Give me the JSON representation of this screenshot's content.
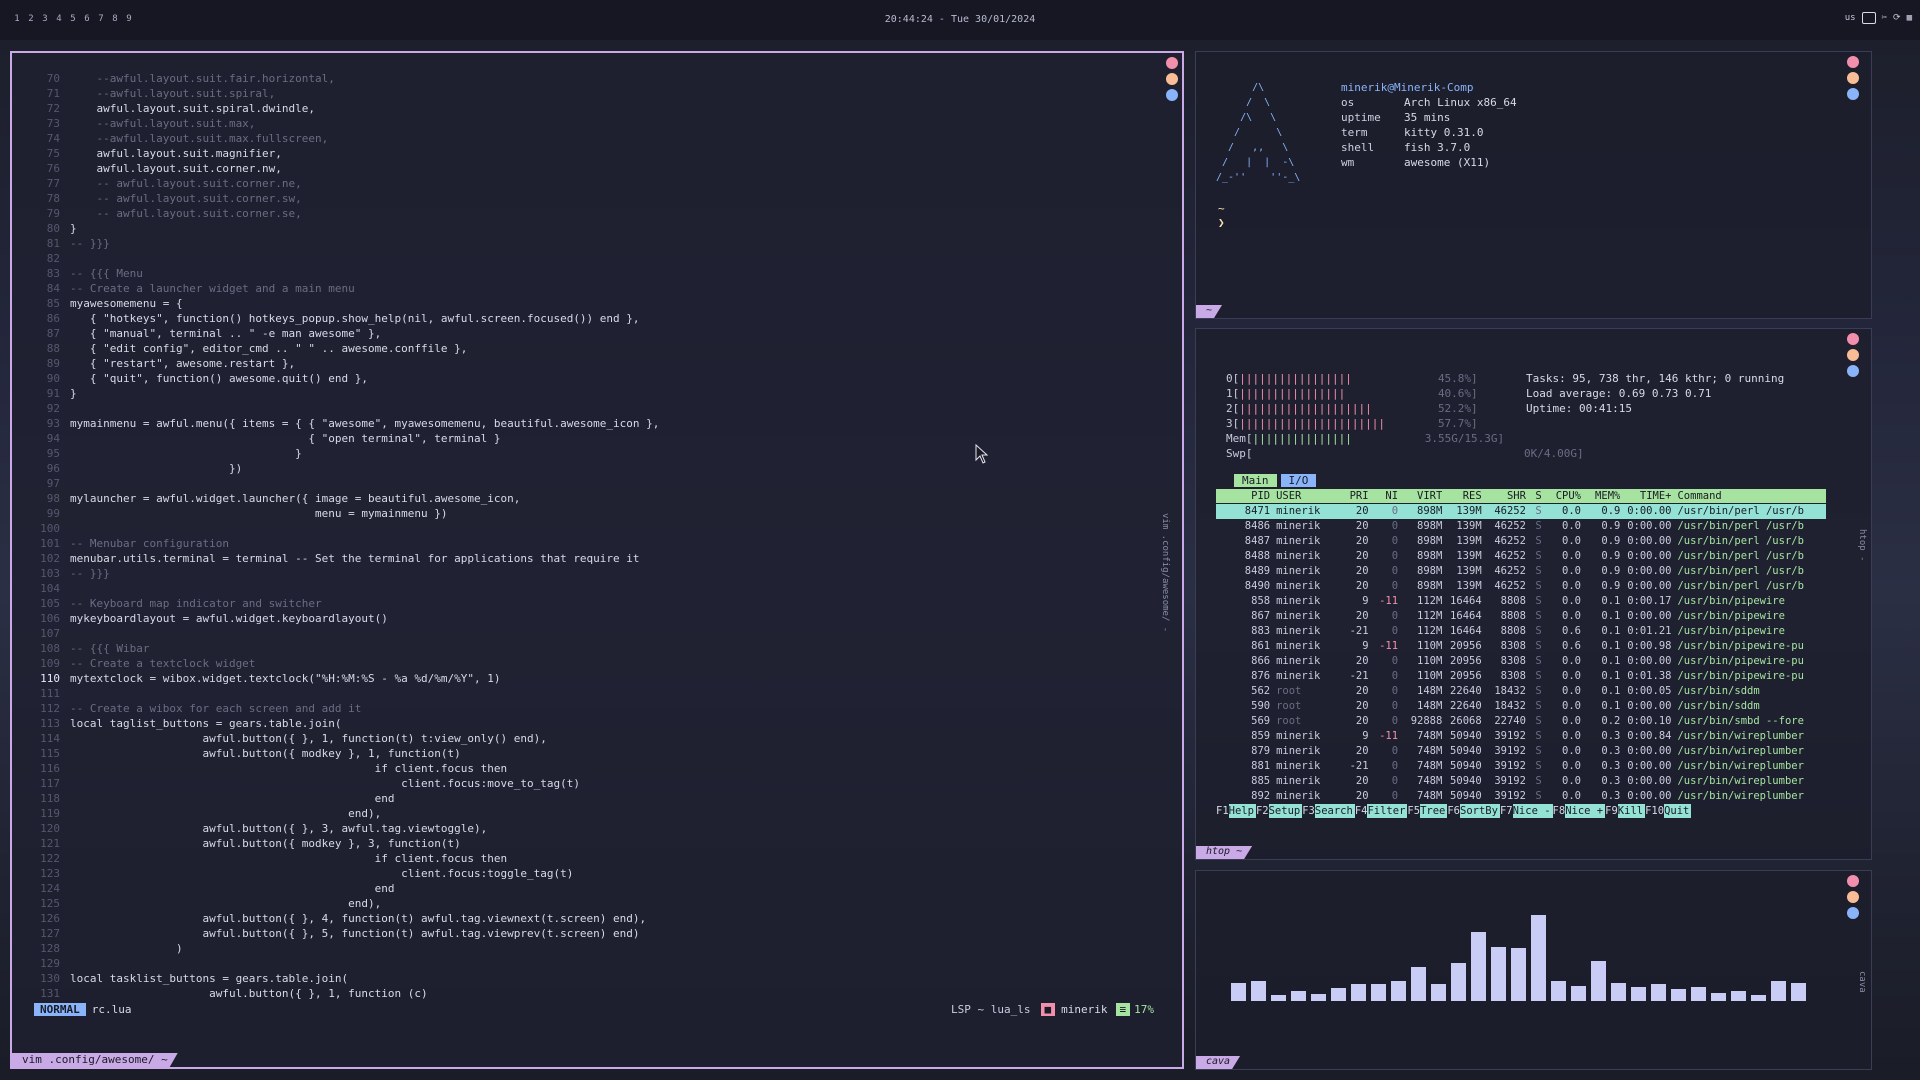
{
  "topbar": {
    "tags": [
      "1",
      "2",
      "3",
      "4",
      "5",
      "6",
      "7",
      "8",
      "9"
    ],
    "clock": "20:44:24 - Tue 30/01/2024",
    "layout": "us"
  },
  "vim": {
    "lines": [
      {
        "n": "70",
        "t": "    --awful.layout.suit.fair.horizontal,",
        "c": true
      },
      {
        "n": "71",
        "t": "    --awful.layout.suit.spiral,",
        "c": true
      },
      {
        "n": "72",
        "t": "    awful.layout.suit.spiral.dwindle,"
      },
      {
        "n": "73",
        "t": "    --awful.layout.suit.max,",
        "c": true
      },
      {
        "n": "74",
        "t": "    --awful.layout.suit.max.fullscreen,",
        "c": true
      },
      {
        "n": "75",
        "t": "    awful.layout.suit.magnifier,"
      },
      {
        "n": "76",
        "t": "    awful.layout.suit.corner.nw,"
      },
      {
        "n": "77",
        "t": "    -- awful.layout.suit.corner.ne,",
        "c": true
      },
      {
        "n": "78",
        "t": "    -- awful.layout.suit.corner.sw,",
        "c": true
      },
      {
        "n": "79",
        "t": "    -- awful.layout.suit.corner.se,",
        "c": true
      },
      {
        "n": "80",
        "t": "}"
      },
      {
        "n": "81",
        "t": "-- }}}",
        "c": true
      },
      {
        "n": "82",
        "t": ""
      },
      {
        "n": "83",
        "t": "-- {{{ Menu",
        "c": true
      },
      {
        "n": "84",
        "t": "-- Create a launcher widget and a main menu",
        "c": true
      },
      {
        "n": "85",
        "t": "myawesomemenu = {"
      },
      {
        "n": "86",
        "t": "   { \"hotkeys\", function() hotkeys_popup.show_help(nil, awful.screen.focused()) end },"
      },
      {
        "n": "87",
        "t": "   { \"manual\", terminal .. \" -e man awesome\" },"
      },
      {
        "n": "88",
        "t": "   { \"edit config\", editor_cmd .. \" \" .. awesome.conffile },"
      },
      {
        "n": "89",
        "t": "   { \"restart\", awesome.restart },"
      },
      {
        "n": "90",
        "t": "   { \"quit\", function() awesome.quit() end },"
      },
      {
        "n": "91",
        "t": "}"
      },
      {
        "n": "92",
        "t": ""
      },
      {
        "n": "93",
        "t": "mymainmenu = awful.menu({ items = { { \"awesome\", myawesomemenu, beautiful.awesome_icon },"
      },
      {
        "n": "94",
        "t": "                                    { \"open terminal\", terminal }"
      },
      {
        "n": "95",
        "t": "                                  }"
      },
      {
        "n": "96",
        "t": "                        })"
      },
      {
        "n": "97",
        "t": ""
      },
      {
        "n": "98",
        "t": "mylauncher = awful.widget.launcher({ image = beautiful.awesome_icon,"
      },
      {
        "n": "99",
        "t": "                                     menu = mymainmenu })"
      },
      {
        "n": "100",
        "t": ""
      },
      {
        "n": "101",
        "t": "-- Menubar configuration",
        "c": true
      },
      {
        "n": "102",
        "t": "menubar.utils.terminal = terminal -- Set the terminal for applications that require it"
      },
      {
        "n": "103",
        "t": "-- }}}",
        "c": true
      },
      {
        "n": "104",
        "t": ""
      },
      {
        "n": "105",
        "t": "-- Keyboard map indicator and switcher",
        "c": true
      },
      {
        "n": "106",
        "t": "mykeyboardlayout = awful.widget.keyboardlayout()"
      },
      {
        "n": "107",
        "t": ""
      },
      {
        "n": "108",
        "t": "-- {{{ Wibar",
        "c": true
      },
      {
        "n": "109",
        "t": "-- Create a textclock widget",
        "c": true
      },
      {
        "n": "110",
        "t": "mytextclock = wibox.widget.textclock(\"%H:%M:%S - %a %d/%m/%Y\", 1)",
        "cur": true
      },
      {
        "n": "111",
        "t": ""
      },
      {
        "n": "112",
        "t": "-- Create a wibox for each screen and add it",
        "c": true
      },
      {
        "n": "113",
        "t": "local taglist_buttons = gears.table.join("
      },
      {
        "n": "114",
        "t": "                    awful.button({ }, 1, function(t) t:view_only() end),"
      },
      {
        "n": "115",
        "t": "                    awful.button({ modkey }, 1, function(t)"
      },
      {
        "n": "116",
        "t": "                                              if client.focus then"
      },
      {
        "n": "117",
        "t": "                                                  client.focus:move_to_tag(t)"
      },
      {
        "n": "118",
        "t": "                                              end"
      },
      {
        "n": "119",
        "t": "                                          end),"
      },
      {
        "n": "120",
        "t": "                    awful.button({ }, 3, awful.tag.viewtoggle),"
      },
      {
        "n": "121",
        "t": "                    awful.button({ modkey }, 3, function(t)"
      },
      {
        "n": "122",
        "t": "                                              if client.focus then"
      },
      {
        "n": "123",
        "t": "                                                  client.focus:toggle_tag(t)"
      },
      {
        "n": "124",
        "t": "                                              end"
      },
      {
        "n": "125",
        "t": "                                          end),"
      },
      {
        "n": "126",
        "t": "                    awful.button({ }, 4, function(t) awful.tag.viewnext(t.screen) end),"
      },
      {
        "n": "127",
        "t": "                    awful.button({ }, 5, function(t) awful.tag.viewprev(t.screen) end)"
      },
      {
        "n": "128",
        "t": "                )"
      },
      {
        "n": "129",
        "t": ""
      },
      {
        "n": "130",
        "t": "local tasklist_buttons = gears.table.join("
      },
      {
        "n": "131",
        "t": "                     awful.button({ }, 1, function (c)"
      }
    ],
    "mode": "NORMAL",
    "file": "rc.lua",
    "lsp": "LSP ~ lua_ls",
    "user": "minerik",
    "percent": "17%",
    "side_title": "vim .config/awesome/ -",
    "tab": "vim .config/awesome/ ~"
  },
  "fetch": {
    "ascii": "      /\\\n     /  \\\n    /\\   \\\n   /      \\\n  /   ,,   \\\n /   |  |  -\\\n/_-''    ''-_\\",
    "host": "minerik@Minerik-Comp",
    "rows": [
      {
        "k": "os",
        "v": "Arch Linux x86_64"
      },
      {
        "k": "uptime",
        "v": "35 mins"
      },
      {
        "k": "term",
        "v": "kitty 0.31.0"
      },
      {
        "k": "shell",
        "v": "fish 3.7.0"
      },
      {
        "k": "wm",
        "v": "awesome (X11)"
      }
    ],
    "prompt1": "~",
    "prompt2": "❯",
    "tab": "~"
  },
  "htop": {
    "cpus": [
      {
        "l": "0[",
        "b": "|||||||||||||||||",
        "p": "45.8%]"
      },
      {
        "l": "1[",
        "b": "||||||||||||||||",
        "p": "40.6%]"
      },
      {
        "l": "2[",
        "b": "||||||||||||||||||||",
        "p": "52.2%]"
      },
      {
        "l": "3[",
        "b": "||||||||||||||||||||||",
        "p": "57.7%]"
      }
    ],
    "mem": {
      "l": "Mem[",
      "b": "|||||||||||||||",
      "p": "3.55G/15.3G]"
    },
    "swp": {
      "l": "Swp[",
      "b": "",
      "p": "0K/4.00G]"
    },
    "tasks_line": "Tasks: 95, 738 thr, 146 kthr; 0 running",
    "load_line": "Load average: 0.69 0.73 0.71",
    "uptime_line": "Uptime: 00:41:15",
    "tabs": [
      "Main",
      "I/O"
    ],
    "headers": [
      "PID",
      "USER",
      "PRI",
      "NI",
      "VIRT",
      "RES",
      "SHR",
      "S",
      "CPU%",
      "MEM%",
      "TIME+",
      "Command"
    ],
    "procs": [
      [
        "8471",
        "minerik",
        "20",
        "0",
        "898M",
        "139M",
        "46252",
        "S",
        "0.0",
        "0.9",
        "0:00.00",
        "/usr/bin/perl /usr/b"
      ],
      [
        "8486",
        "minerik",
        "20",
        "0",
        "898M",
        "139M",
        "46252",
        "S",
        "0.0",
        "0.9",
        "0:00.00",
        "/usr/bin/perl /usr/b"
      ],
      [
        "8487",
        "minerik",
        "20",
        "0",
        "898M",
        "139M",
        "46252",
        "S",
        "0.0",
        "0.9",
        "0:00.00",
        "/usr/bin/perl /usr/b"
      ],
      [
        "8488",
        "minerik",
        "20",
        "0",
        "898M",
        "139M",
        "46252",
        "S",
        "0.0",
        "0.9",
        "0:00.00",
        "/usr/bin/perl /usr/b"
      ],
      [
        "8489",
        "minerik",
        "20",
        "0",
        "898M",
        "139M",
        "46252",
        "S",
        "0.0",
        "0.9",
        "0:00.00",
        "/usr/bin/perl /usr/b"
      ],
      [
        "8490",
        "minerik",
        "20",
        "0",
        "898M",
        "139M",
        "46252",
        "S",
        "0.0",
        "0.9",
        "0:00.00",
        "/usr/bin/perl /usr/b"
      ],
      [
        "858",
        "minerik",
        "9",
        "-11",
        "112M",
        "16464",
        "8808",
        "S",
        "0.0",
        "0.1",
        "0:00.17",
        "/usr/bin/pipewire"
      ],
      [
        "867",
        "minerik",
        "20",
        "0",
        "112M",
        "16464",
        "8808",
        "S",
        "0.0",
        "0.1",
        "0:00.00",
        "/usr/bin/pipewire"
      ],
      [
        "883",
        "minerik",
        "-21",
        "0",
        "112M",
        "16464",
        "8808",
        "S",
        "0.6",
        "0.1",
        "0:01.21",
        "/usr/bin/pipewire"
      ],
      [
        "861",
        "minerik",
        "9",
        "-11",
        "110M",
        "20956",
        "8308",
        "S",
        "0.6",
        "0.1",
        "0:00.98",
        "/usr/bin/pipewire-pu"
      ],
      [
        "866",
        "minerik",
        "20",
        "0",
        "110M",
        "20956",
        "8308",
        "S",
        "0.0",
        "0.1",
        "0:00.00",
        "/usr/bin/pipewire-pu"
      ],
      [
        "876",
        "minerik",
        "-21",
        "0",
        "110M",
        "20956",
        "8308",
        "S",
        "0.0",
        "0.1",
        "0:01.38",
        "/usr/bin/pipewire-pu"
      ],
      [
        "562",
        "root",
        "20",
        "0",
        "148M",
        "22640",
        "18432",
        "S",
        "0.0",
        "0.1",
        "0:00.05",
        "/usr/bin/sddm"
      ],
      [
        "590",
        "root",
        "20",
        "0",
        "148M",
        "22640",
        "18432",
        "S",
        "0.0",
        "0.1",
        "0:00.00",
        "/usr/bin/sddm"
      ],
      [
        "569",
        "root",
        "20",
        "0",
        "92888",
        "26068",
        "22740",
        "S",
        "0.0",
        "0.2",
        "0:00.10",
        "/usr/bin/smbd --fore"
      ],
      [
        "859",
        "minerik",
        "9",
        "-11",
        "748M",
        "50940",
        "39192",
        "S",
        "0.0",
        "0.3",
        "0:00.84",
        "/usr/bin/wireplumber"
      ],
      [
        "879",
        "minerik",
        "20",
        "0",
        "748M",
        "50940",
        "39192",
        "S",
        "0.0",
        "0.3",
        "0:00.00",
        "/usr/bin/wireplumber"
      ],
      [
        "881",
        "minerik",
        "-21",
        "0",
        "748M",
        "50940",
        "39192",
        "S",
        "0.0",
        "0.3",
        "0:00.00",
        "/usr/bin/wireplumber"
      ],
      [
        "885",
        "minerik",
        "20",
        "0",
        "748M",
        "50940",
        "39192",
        "S",
        "0.0",
        "0.3",
        "0:00.00",
        "/usr/bin/wireplumber"
      ],
      [
        "892",
        "minerik",
        "20",
        "0",
        "748M",
        "50940",
        "39192",
        "S",
        "0.0",
        "0.3",
        "0:00.00",
        "/usr/bin/wireplumber"
      ]
    ],
    "fkeys": [
      {
        "k": "F1",
        "l": "Help  "
      },
      {
        "k": "F2",
        "l": "Setup "
      },
      {
        "k": "F3",
        "l": "Search"
      },
      {
        "k": "F4",
        "l": "Filter"
      },
      {
        "k": "F5",
        "l": "Tree  "
      },
      {
        "k": "F6",
        "l": "SortBy"
      },
      {
        "k": "F7",
        "l": "Nice -"
      },
      {
        "k": "F8",
        "l": "Nice +"
      },
      {
        "k": "F9",
        "l": "Kill  "
      },
      {
        "k": "F10",
        "l": "Quit    "
      }
    ],
    "tab": "htop ~",
    "side_title": "htop -"
  },
  "cava": {
    "levels": [
      0.18,
      0.2,
      0.06,
      0.1,
      0.07,
      0.13,
      0.17,
      0.17,
      0.2,
      0.34,
      0.17,
      0.38,
      0.69,
      0.54,
      0.53,
      0.86,
      0.2,
      0.15,
      0.4,
      0.18,
      0.14,
      0.17,
      0.12,
      0.14,
      0.08,
      0.1,
      0.06,
      0.2,
      0.18
    ],
    "tab": "cava",
    "side_title": "cava"
  },
  "colors": {
    "accent": "#c9a9e6",
    "blue": "#89b4fa",
    "green": "#a6e3a1",
    "red": "#f28fad",
    "peach": "#f8bd96"
  }
}
